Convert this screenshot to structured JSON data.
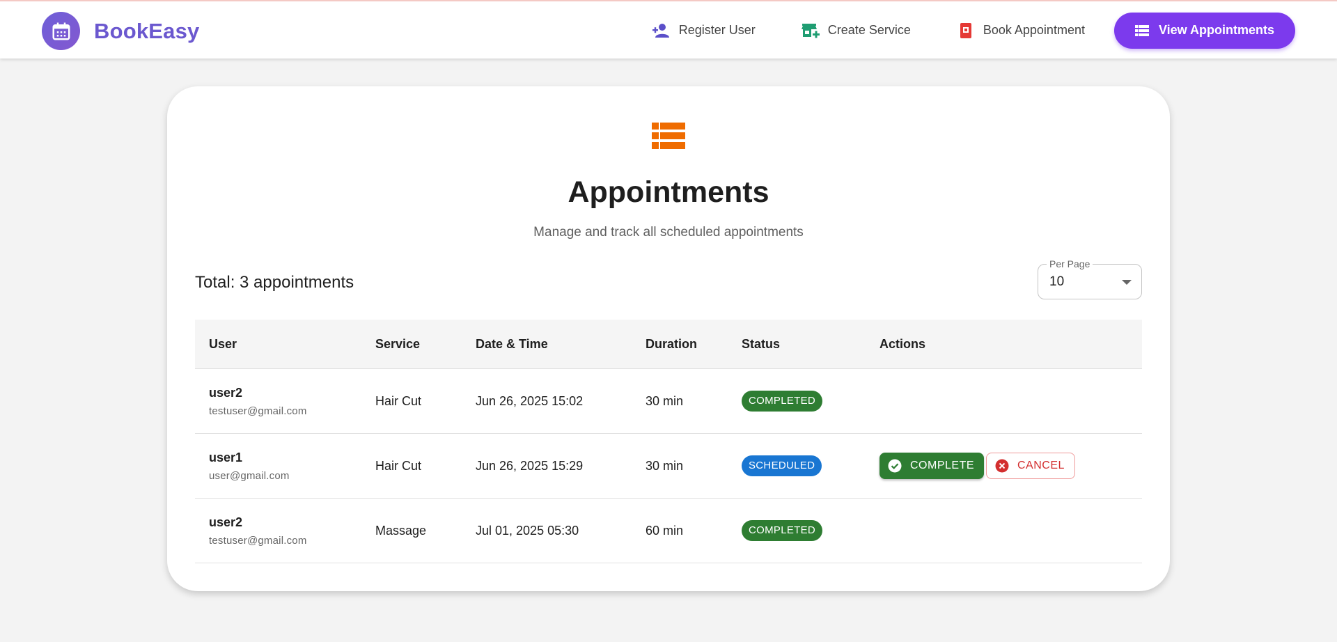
{
  "brand": {
    "name": "BookEasy",
    "logo_icon": "calendar-icon",
    "color": "#6b58cf"
  },
  "nav": {
    "items": [
      {
        "label": "Register User",
        "icon": "person-add-icon",
        "color": "#5b4fc9"
      },
      {
        "label": "Create Service",
        "icon": "store-add-icon",
        "color": "#1f9d72"
      },
      {
        "label": "Book Appointment",
        "icon": "book-icon",
        "color": "#e53935"
      }
    ],
    "active": {
      "label": "View Appointments",
      "icon": "list-icon",
      "color": "#7c3aed"
    }
  },
  "page": {
    "icon": "list-icon",
    "icon_color": "#ef6c00",
    "title": "Appointments",
    "subtitle": "Manage and track all scheduled appointments",
    "total": "Total: 3 appointments",
    "per_page": {
      "label": "Per Page",
      "value": "10"
    }
  },
  "table": {
    "headers": [
      "User",
      "Service",
      "Date & Time",
      "Duration",
      "Status",
      "Actions"
    ],
    "rows": [
      {
        "user": "user2",
        "email": "testuser@gmail.com",
        "service": "Hair Cut",
        "datetime": "Jun 26, 2025 15:02",
        "duration": "30 min",
        "status": "COMPLETED",
        "actions": []
      },
      {
        "user": "user1",
        "email": "user@gmail.com",
        "service": "Hair Cut",
        "datetime": "Jun 26, 2025 15:29",
        "duration": "30 min",
        "status": "SCHEDULED",
        "actions": [
          "COMPLETE",
          "CANCEL"
        ]
      },
      {
        "user": "user2",
        "email": "testuser@gmail.com",
        "service": "Massage",
        "datetime": "Jul 01, 2025 05:30",
        "duration": "60 min",
        "status": "COMPLETED",
        "actions": []
      }
    ]
  },
  "colors": {
    "completed": "#2e7d32",
    "scheduled": "#1976d2",
    "cancel": "#d32f2f"
  }
}
